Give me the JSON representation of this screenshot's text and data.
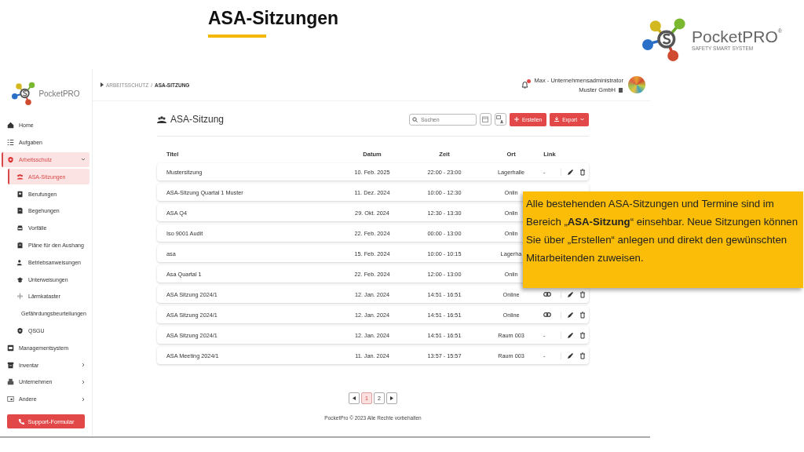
{
  "slide": {
    "title": "ASA-Sitzungen",
    "logo": {
      "name": "PocketPRO",
      "tagline": "SAFETY SMART SYSTEM",
      "mark": "®"
    }
  },
  "sidebar": {
    "logo": "PocketPRO",
    "items": [
      {
        "label": "Home",
        "selected": false
      },
      {
        "label": "Aufgaben",
        "selected": false
      },
      {
        "label": "Arbeitsschutz",
        "selected": true,
        "expanded": true,
        "children": [
          {
            "label": "ASA-Sitzungen",
            "selected": true
          },
          {
            "label": "Berufungen",
            "selected": false
          },
          {
            "label": "Begehungen",
            "selected": false
          },
          {
            "label": "Vorfälle",
            "selected": false
          },
          {
            "label": "Pläne für den Aushang",
            "selected": false
          },
          {
            "label": "Betriebsanweisungen",
            "selected": false
          },
          {
            "label": "Unterweisungen",
            "selected": false
          },
          {
            "label": "Lärmkataster",
            "selected": false
          },
          {
            "label": "Gefährdungsbeurteilungen",
            "selected": false
          },
          {
            "label": "QSGU",
            "selected": false
          }
        ]
      },
      {
        "label": "Managementsystem",
        "selected": false
      },
      {
        "label": "Inventar",
        "selected": false,
        "expanded": false
      },
      {
        "label": "Unternehmen",
        "selected": false,
        "expanded": false
      },
      {
        "label": "Andere",
        "selected": false,
        "expanded": false
      }
    ],
    "support_button": "Support-Formular"
  },
  "header": {
    "breadcrumb": [
      "ARBEITSSCHUTZ",
      "/",
      "ASA-SITZUNG"
    ],
    "user": "Max - Unternehmensadministrator",
    "company": "Muster GmbH"
  },
  "page": {
    "title": "ASA-Sitzung",
    "search": {
      "placeholder": "Suchen"
    },
    "create_button": "Erstellen",
    "export_button": "Export"
  },
  "table": {
    "columns": [
      "Titel",
      "Datum",
      "Zeit",
      "Ort",
      "Link"
    ],
    "rows": [
      {
        "titel": "Mustersitzung",
        "datum": "10. Feb. 2025",
        "zeit": "22:00 - 23:00",
        "ort": "Lagerhalle",
        "link": {
          "kind": "text",
          "text": "-"
        },
        "actions": true
      },
      {
        "titel": "ASA-Sitzung Quartal 1 Muster",
        "datum": "11. Dez. 2024",
        "zeit": "10:00 - 12:30",
        "ort": "Onlin"
      },
      {
        "titel": "ASA Q4",
        "datum": "29. Okt. 2024",
        "zeit": "12:30 - 13:30",
        "ort": "Onlin"
      },
      {
        "titel": "Iso 9001 Audit",
        "datum": "22. Feb. 2024",
        "zeit": "00:00 - 13:00",
        "ort": "Onlin"
      },
      {
        "titel": "asa",
        "datum": "15. Feb. 2024",
        "zeit": "10:00 - 10:15",
        "ort": "Lagerha"
      },
      {
        "titel": "Asa Quartal 1",
        "datum": "22. Feb. 2024",
        "zeit": "12:00 - 13:00",
        "ort": "Onlin"
      },
      {
        "titel": "ASA Sitzung 2024/1",
        "datum": "12. Jan. 2024",
        "zeit": "14:51 - 16:51",
        "ort": "Online",
        "link": {
          "kind": "icon"
        },
        "actions": true
      },
      {
        "titel": "ASA Sitzung 2024/1",
        "datum": "12. Jan. 2024",
        "zeit": "14:51 - 16:51",
        "ort": "Online",
        "link": {
          "kind": "icon"
        },
        "actions": true
      },
      {
        "titel": "ASA Sitzung 2024/1",
        "datum": "12. Jan. 2024",
        "zeit": "14:51 - 16:51",
        "ort": "Raum 003",
        "link": {
          "kind": "text",
          "text": "-"
        },
        "actions": true
      },
      {
        "titel": "ASA Meeting 2024/1",
        "datum": "11. Jan. 2024",
        "zeit": "13:57 - 15:57",
        "ort": "Raum 003",
        "link": {
          "kind": "text",
          "text": "-"
        },
        "actions": true
      }
    ]
  },
  "pagination": {
    "pages": [
      {
        "label": "1",
        "selected": true
      },
      {
        "label": "2",
        "selected": false
      }
    ]
  },
  "footer": "PocketPro © 2023 Alle Rechte vorbehalten",
  "callout": {
    "text": "Alle bestehenden ASA-Sitzungen und Termine sind im Bereich „**ASA-Sitzung**“ einsehbar. Neue Sitzungen können Sie über „Erstellen“ anlegen und direkt den gewünschten Mitarbeitenden zuweisen."
  }
}
